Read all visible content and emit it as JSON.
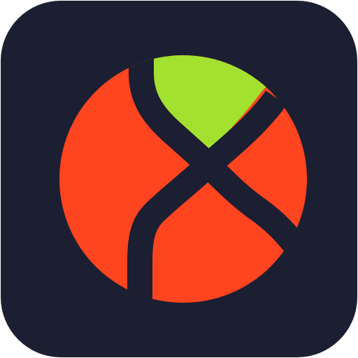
{
  "icon": {
    "name": "app-logo-icon",
    "colors": {
      "tile_background": "#1B1F31",
      "circle_fill": "#FF4420",
      "accent_segment": "#A3E030",
      "stroke": "#1B1F31"
    }
  }
}
